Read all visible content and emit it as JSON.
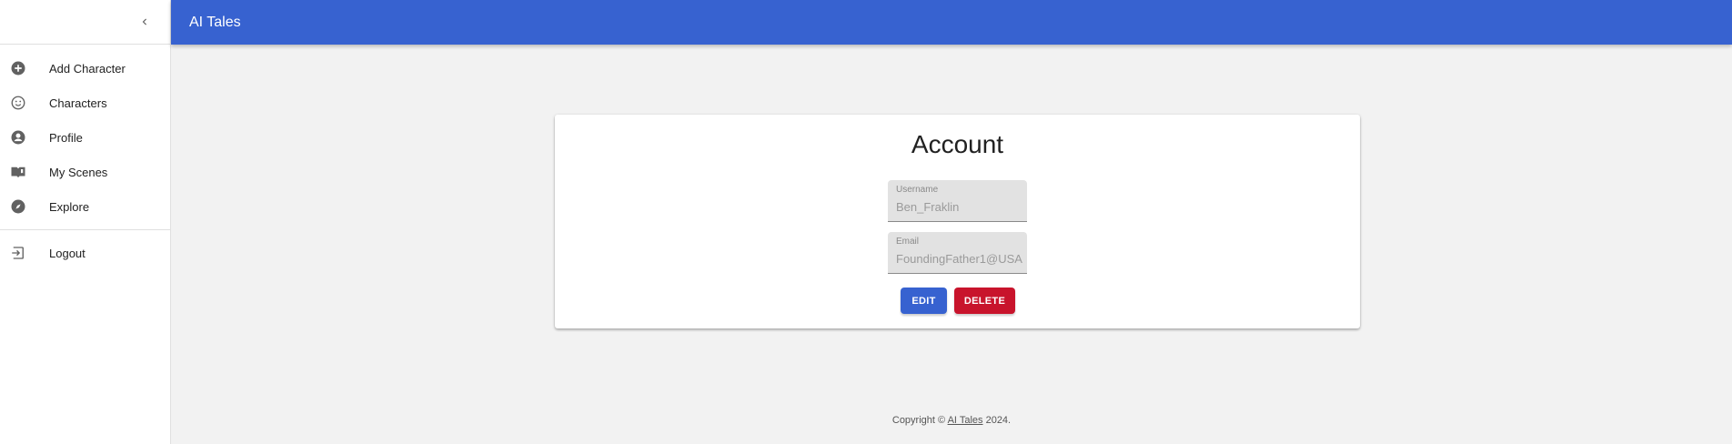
{
  "app": {
    "title": "AI Tales"
  },
  "drawer": {
    "collapse_icon": "chevron-left-icon",
    "items": [
      {
        "label": "Add Character",
        "icon": "add-circle-icon"
      },
      {
        "label": "Characters",
        "icon": "smiley-icon"
      },
      {
        "label": "Profile",
        "icon": "account-circle-icon"
      },
      {
        "label": "My Scenes",
        "icon": "book-icon"
      },
      {
        "label": "Explore",
        "icon": "compass-icon"
      }
    ],
    "logout": {
      "label": "Logout",
      "icon": "logout-icon"
    }
  },
  "account": {
    "title": "Account",
    "username": {
      "label": "Username",
      "value": "Ben_Fraklin"
    },
    "email": {
      "label": "Email",
      "value": "FoundingFather1@USA"
    },
    "edit_label": "EDIT",
    "delete_label": "DELETE"
  },
  "footer": {
    "prefix": "Copyright ©",
    "link": "AI Tales",
    "suffix": "2024."
  },
  "colors": {
    "primary": "#3762d0",
    "danger": "#c8142c",
    "background": "#f2f2f2"
  }
}
